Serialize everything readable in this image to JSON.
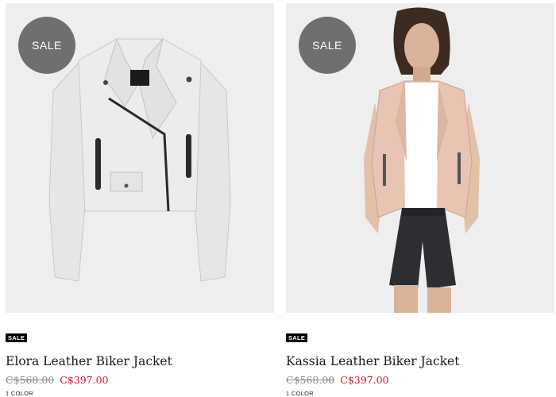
{
  "products": [
    {
      "badge": "SALE",
      "tag": "SALE",
      "name": "Elora Leather Biker Jacket",
      "original_price": "C$568.00",
      "sale_price": "C$397.00",
      "colors": "1 COLOR",
      "jacket_color": "#e9e9e7"
    },
    {
      "badge": "SALE",
      "tag": "SALE",
      "name": "Kassia Leather Biker Jacket",
      "original_price": "C$568.00",
      "sale_price": "C$397.00",
      "colors": "1 COLOR",
      "jacket_color": "#e8c4b4"
    }
  ],
  "colors": {
    "sale_price": "#c8102e",
    "original_price": "#8a8a8a",
    "image_bg": "#eeeeee",
    "badge_bg": "#6f6f6f"
  }
}
